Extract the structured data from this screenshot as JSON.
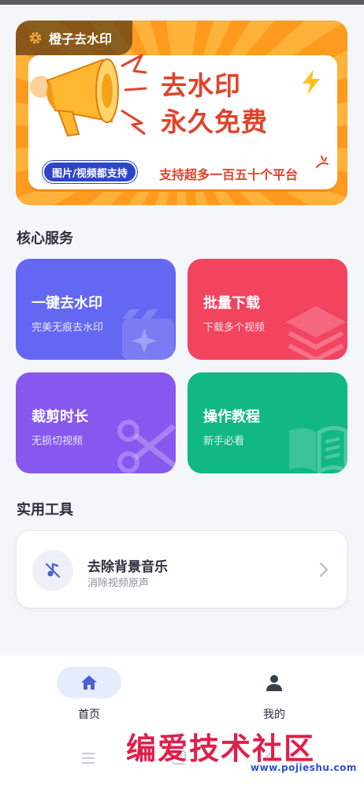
{
  "banner": {
    "tag_label": "橙子去水印",
    "headline_line1": "去水印",
    "headline_line2": "永久免费",
    "pill_text": "图片/视频都支持",
    "sub_text": "支持超多一百五十个平台"
  },
  "sections": {
    "core_title": "核心服务",
    "tools_title": "实用工具"
  },
  "services": [
    {
      "title": "一键去水印",
      "subtitle": "完美无痕去水印",
      "color": "#6367f1",
      "icon": "film-sparkle-icon"
    },
    {
      "title": "批量下载",
      "subtitle": "下载多个视频",
      "color": "#f2435f",
      "icon": "layers-icon"
    },
    {
      "title": "裁剪时长",
      "subtitle": "无损切视频",
      "color": "#8658ef",
      "icon": "scissors-icon"
    },
    {
      "title": "操作教程",
      "subtitle": "新手必看",
      "color": "#12b883",
      "icon": "book-icon"
    }
  ],
  "tools": [
    {
      "title": "去除背景音乐",
      "subtitle": "消除视频原声",
      "icon": "music-off-icon"
    }
  ],
  "bottom_nav": {
    "items": [
      {
        "label": "首页",
        "icon": "home-icon",
        "active": true
      },
      {
        "label": "我的",
        "icon": "person-icon",
        "active": false
      }
    ],
    "active_color": "#4a5fd8"
  },
  "watermark": {
    "text": "编爱技术社区",
    "url": "www.pojieshu.com"
  }
}
